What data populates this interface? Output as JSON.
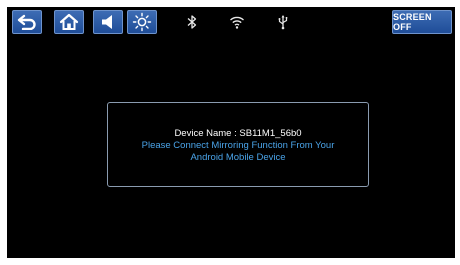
{
  "toolbar": {
    "back_icon": "back-arrow-icon",
    "home_icon": "home-icon",
    "volume_icon": "speaker-icon",
    "brightness_icon": "sun-icon",
    "screen_off_label": "SCREEN OFF",
    "accent_color": "#2a5aa6"
  },
  "status": {
    "bluetooth_icon": "bluetooth-icon",
    "wifi_icon": "wifi-icon",
    "usb_icon": "usb-icon"
  },
  "dialog": {
    "device_name_label": "Device Name :",
    "device_name_value": "SB11M1_56b0",
    "message_lines": [
      "Please Connect Mirroring Function From Your",
      "Android Mobile Device"
    ],
    "message_color": "#4aa3e8"
  }
}
